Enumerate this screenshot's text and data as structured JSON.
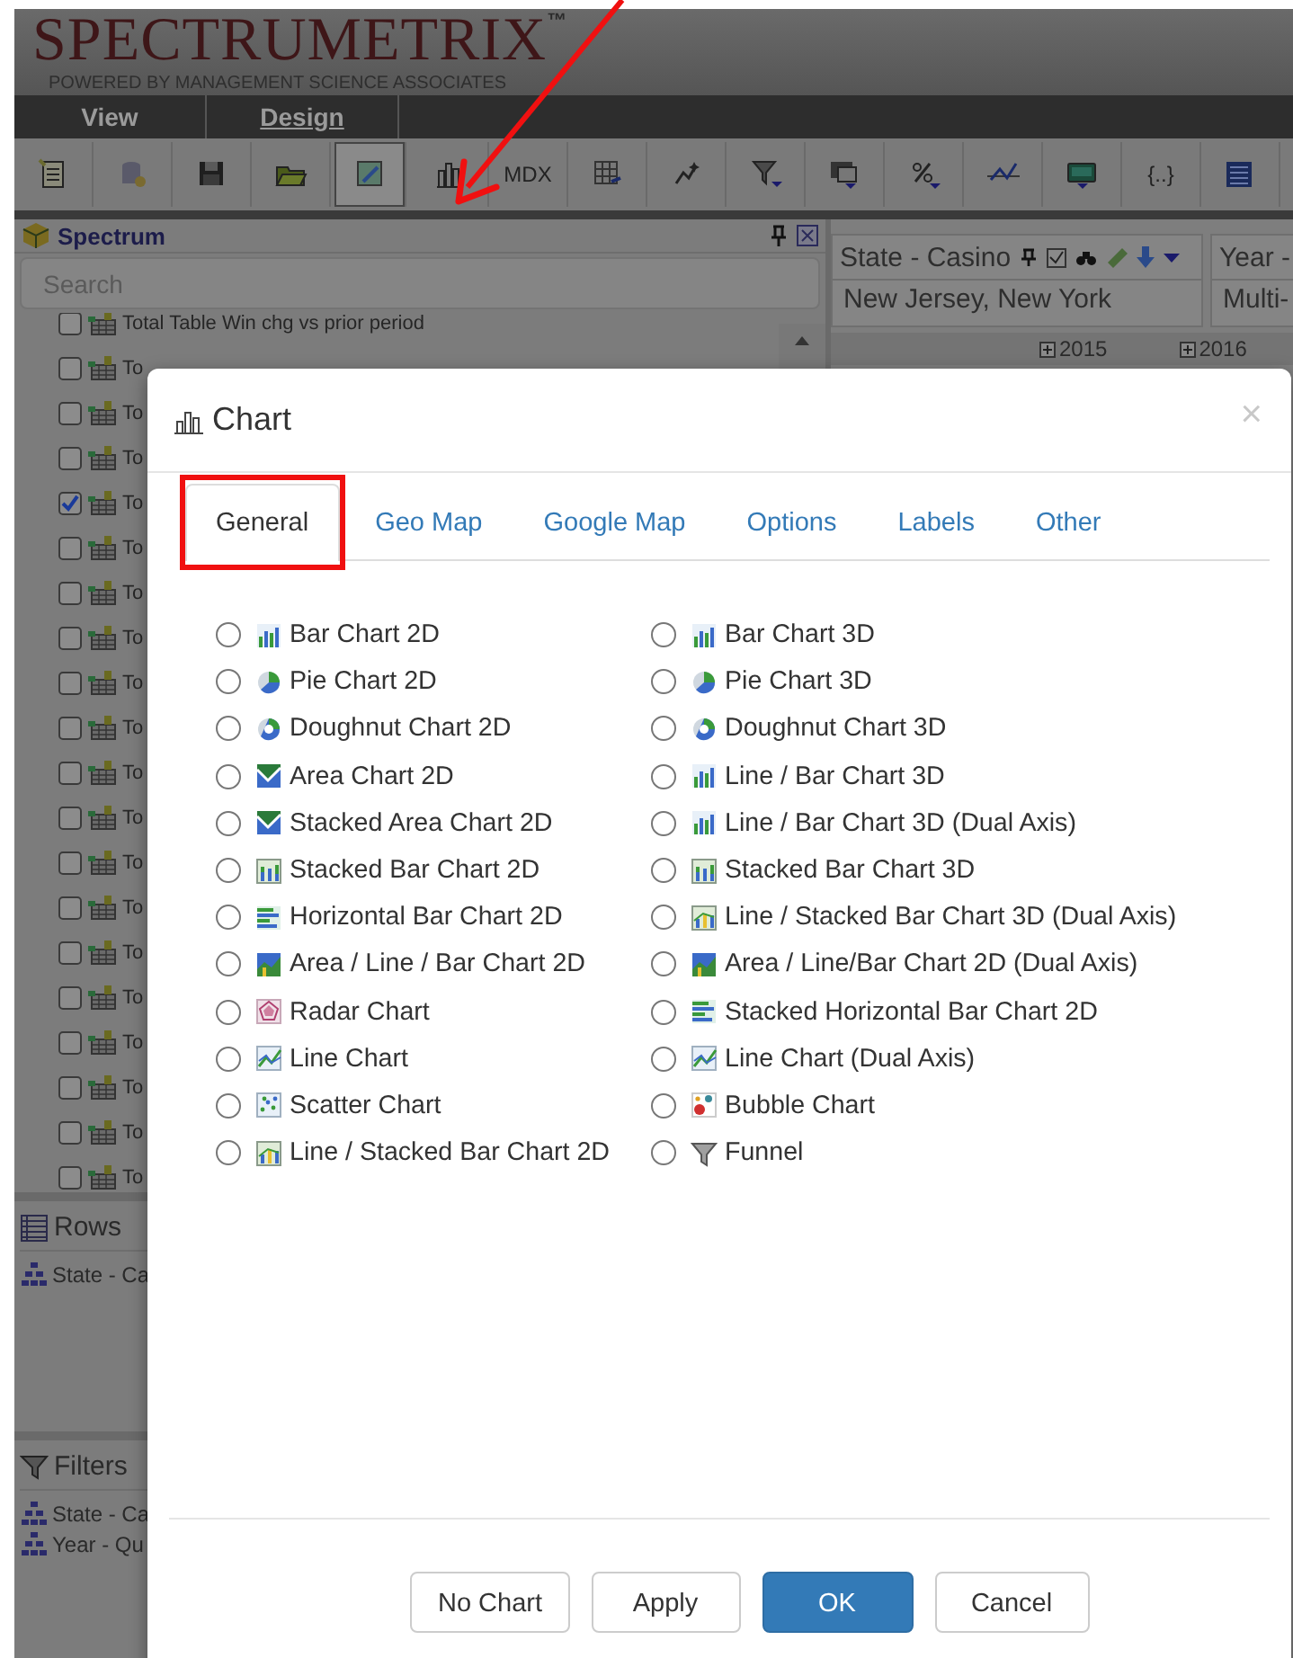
{
  "header": {
    "logo": "SPECTRUMETRIX",
    "trademark": "™",
    "tagline": "POWERED BY MANAGEMENT SCIENCE ASSOCIATES"
  },
  "menu": [
    {
      "label": "View",
      "selected": false
    },
    {
      "label": "Design",
      "selected": true
    }
  ],
  "toolbar": [
    {
      "kind": "icon",
      "pressed": false
    },
    {
      "kind": "icon",
      "pressed": false
    },
    {
      "kind": "icon",
      "pressed": false
    },
    {
      "kind": "icon",
      "pressed": false
    },
    {
      "kind": "icon",
      "pressed": true
    },
    {
      "kind": "icon",
      "pressed": false
    },
    {
      "kind": "text",
      "label": "MDX",
      "pressed": false
    },
    {
      "kind": "icon",
      "pressed": false
    },
    {
      "kind": "icon",
      "pressed": false
    },
    {
      "kind": "icon",
      "pressed": false
    },
    {
      "kind": "icon",
      "pressed": false
    },
    {
      "kind": "icon",
      "pressed": false
    },
    {
      "kind": "icon",
      "pressed": false
    },
    {
      "kind": "icon",
      "pressed": false
    },
    {
      "kind": "text",
      "label": "{..}",
      "pressed": false
    },
    {
      "kind": "icon",
      "pressed": false
    }
  ],
  "panel": {
    "title": "Spectrum",
    "search": {
      "placeholder": "Search"
    },
    "items": [
      {
        "label": "Total Table Win chg vs prior period",
        "checked": false
      },
      {
        "label": "To",
        "checked": false
      },
      {
        "label": "To",
        "checked": false
      },
      {
        "label": "To",
        "checked": false
      },
      {
        "label": "To",
        "checked": true
      },
      {
        "label": "To",
        "checked": false
      },
      {
        "label": "To",
        "checked": false
      },
      {
        "label": "To",
        "checked": false
      },
      {
        "label": "To",
        "checked": false
      },
      {
        "label": "To",
        "checked": false
      },
      {
        "label": "To",
        "checked": false
      },
      {
        "label": "To",
        "checked": false
      },
      {
        "label": "To",
        "checked": false
      },
      {
        "label": "To",
        "checked": false
      },
      {
        "label": "To",
        "checked": false
      },
      {
        "label": "To",
        "checked": false
      },
      {
        "label": "To",
        "checked": false
      },
      {
        "label": "To",
        "checked": false
      },
      {
        "label": "To",
        "checked": false
      },
      {
        "label": "To",
        "checked": false
      }
    ],
    "rows": {
      "title": "Rows",
      "items": [
        "State - Ca"
      ]
    },
    "filters": {
      "title": "Filters",
      "items": [
        "State - Ca",
        "Year - Qu"
      ]
    }
  },
  "pivot": {
    "fields": [
      {
        "title": "State - Casino",
        "value": "New Jersey, New York"
      },
      {
        "title": "Year -",
        "value": "Multi-"
      }
    ],
    "columns": [
      "2015",
      "2016"
    ]
  },
  "dialog": {
    "title": "Chart",
    "close": "×",
    "tabs": [
      {
        "label": "General",
        "selected": true,
        "highlighted": true
      },
      {
        "label": "Geo Map",
        "selected": false,
        "highlighted": false
      },
      {
        "label": "Google Map",
        "selected": false,
        "highlighted": false
      },
      {
        "label": "Options",
        "selected": false,
        "highlighted": false
      },
      {
        "label": "Labels",
        "selected": false,
        "highlighted": false
      },
      {
        "label": "Other",
        "selected": false,
        "highlighted": false
      }
    ],
    "options": [
      [
        {
          "label": "Bar Chart 2D",
          "selected": false
        },
        {
          "label": "Pie Chart 2D",
          "selected": false
        },
        {
          "label": "Doughnut Chart 2D",
          "selected": false
        },
        {
          "label": "Area Chart 2D",
          "selected": false
        },
        {
          "label": "Stacked Area Chart 2D",
          "selected": false
        },
        {
          "label": "Stacked Bar Chart 2D",
          "selected": false
        },
        {
          "label": "Horizontal Bar Chart 2D",
          "selected": false
        },
        {
          "label": "Area / Line / Bar Chart 2D",
          "selected": false
        },
        {
          "label": "Radar Chart",
          "selected": false
        },
        {
          "label": "Line Chart",
          "selected": false
        },
        {
          "label": "Scatter Chart",
          "selected": false
        },
        {
          "label": "Line / Stacked Bar Chart 2D",
          "selected": false
        }
      ],
      [
        {
          "label": "Bar Chart 3D",
          "selected": false
        },
        {
          "label": "Pie Chart 3D",
          "selected": false
        },
        {
          "label": "Doughnut Chart 3D",
          "selected": false
        },
        {
          "label": "Line / Bar Chart 3D",
          "selected": false
        },
        {
          "label": "Line / Bar Chart 3D (Dual Axis)",
          "selected": false
        },
        {
          "label": "Stacked Bar Chart 3D",
          "selected": false
        },
        {
          "label": "Line / Stacked Bar Chart 3D (Dual Axis)",
          "selected": false
        },
        {
          "label": "Area / Line/Bar Chart 2D (Dual Axis)",
          "selected": false
        },
        {
          "label": "Stacked Horizontal Bar Chart 2D",
          "selected": false
        },
        {
          "label": "Line Chart (Dual Axis)",
          "selected": false
        },
        {
          "label": "Bubble Chart",
          "selected": false
        },
        {
          "label": "Funnel",
          "selected": false
        }
      ]
    ],
    "buttons": [
      {
        "label": "No Chart",
        "kind": "default"
      },
      {
        "label": "Apply",
        "kind": "default"
      },
      {
        "label": "OK",
        "kind": "primary"
      },
      {
        "label": "Cancel",
        "kind": "default"
      }
    ]
  }
}
